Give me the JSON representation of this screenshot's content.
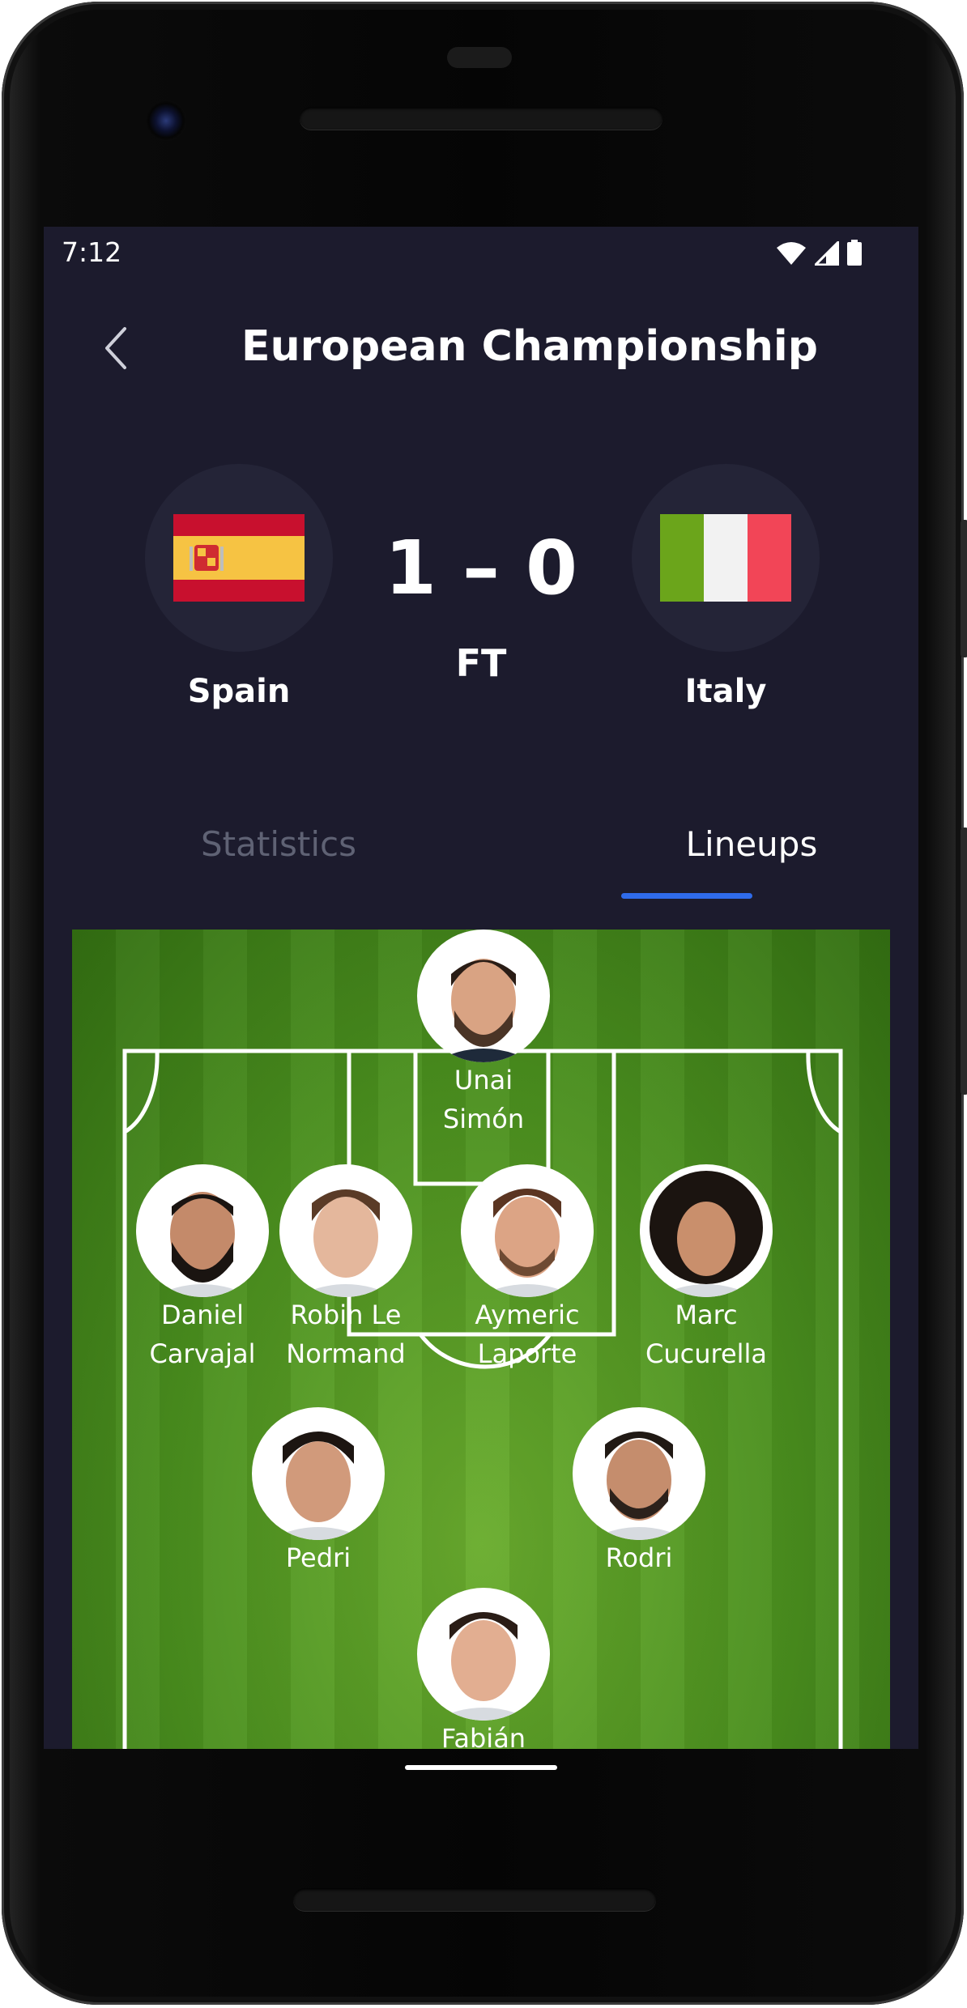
{
  "status_bar": {
    "time": "7:12"
  },
  "header": {
    "title": "European Championship"
  },
  "match": {
    "home_team": "Spain",
    "away_team": "Italy",
    "score": "1 – 0",
    "status": "FT"
  },
  "tabs": [
    {
      "label": "Statistics",
      "active": false
    },
    {
      "label": "Lineups",
      "active": true
    }
  ],
  "lineup": {
    "players": [
      {
        "name": "Unai\nSimón"
      },
      {
        "name": "Daniel\nCarvajal"
      },
      {
        "name": "Robin Le\nNormand"
      },
      {
        "name": "Aymeric\nLaporte"
      },
      {
        "name": "Marc\nCucurella"
      },
      {
        "name": "Pedri"
      },
      {
        "name": "Rodri"
      },
      {
        "name": "Fabián"
      }
    ]
  },
  "colors": {
    "background": "#1c1b2d",
    "accent": "#2f6bea",
    "inactive_tab": "#5f6274",
    "pitch": "#4a8f1e"
  }
}
